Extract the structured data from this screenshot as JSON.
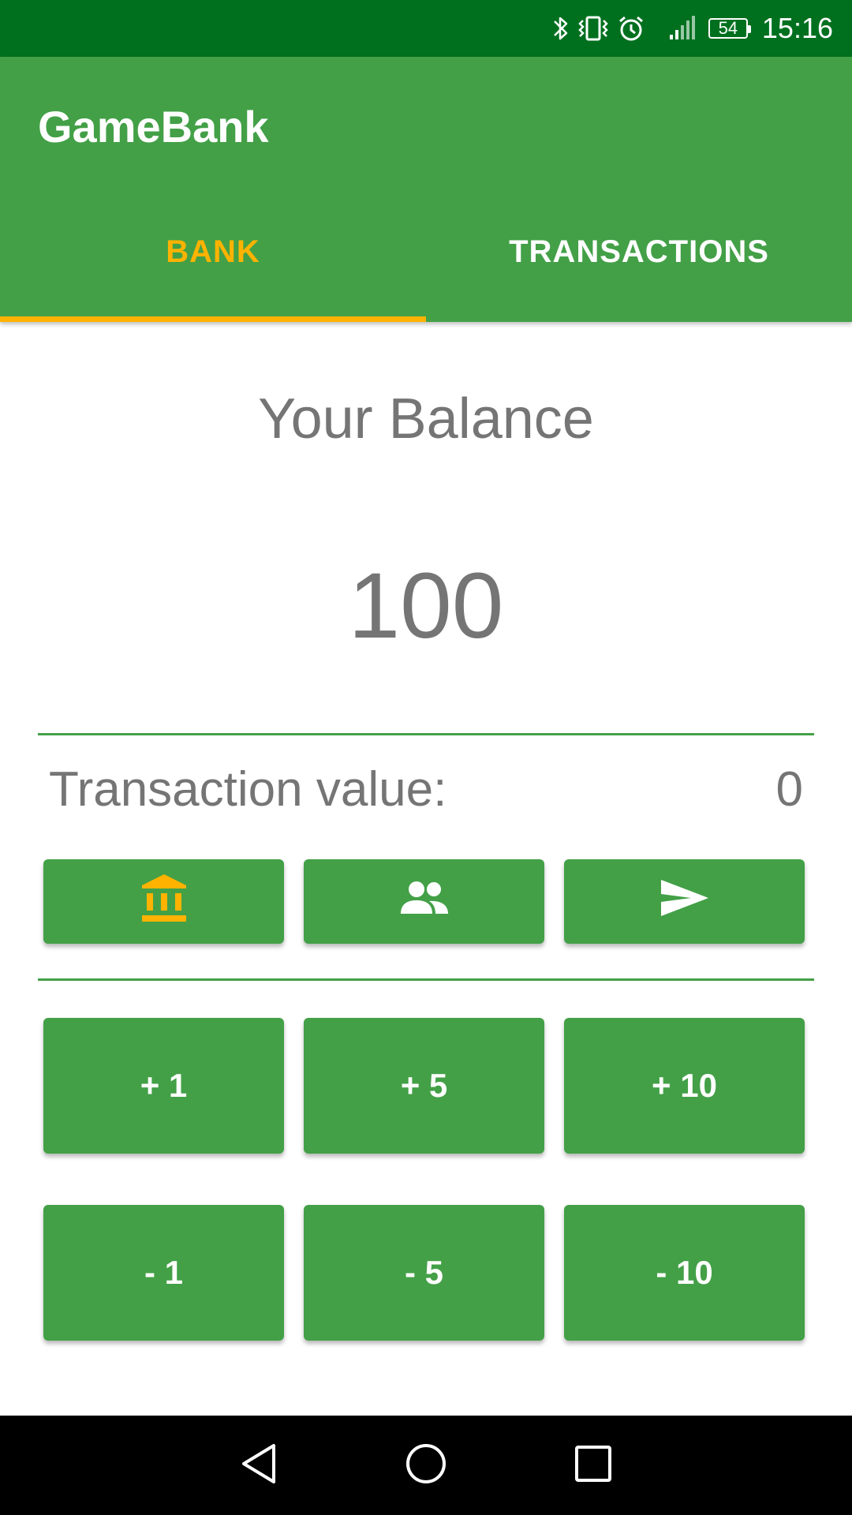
{
  "status_bar": {
    "time": "15:16",
    "battery": "54",
    "icons": [
      "bluetooth-icon",
      "vibrate-icon",
      "alarm-icon",
      "signal-icon",
      "battery-icon"
    ]
  },
  "app": {
    "title": "GameBank"
  },
  "tabs": [
    {
      "label": "BANK",
      "active": true
    },
    {
      "label": "TRANSACTIONS",
      "active": false
    }
  ],
  "balance": {
    "label": "Your Balance",
    "value": "100"
  },
  "transaction": {
    "label": "Transaction value:",
    "value": "0"
  },
  "action_buttons": [
    {
      "icon": "bank-icon"
    },
    {
      "icon": "people-icon"
    },
    {
      "icon": "send-icon"
    }
  ],
  "amount_buttons": {
    "plus": [
      "+ 1",
      "+ 5",
      "+ 10"
    ],
    "minus": [
      "- 1",
      "- 5",
      "- 10"
    ]
  },
  "colors": {
    "status_bar": "#00701f",
    "primary": "#43a047",
    "accent": "#ffb300",
    "text_gray": "#757575",
    "nav_bar": "#000000"
  },
  "nav_bar": {
    "icons": [
      "back-icon",
      "home-icon",
      "recents-icon"
    ]
  }
}
